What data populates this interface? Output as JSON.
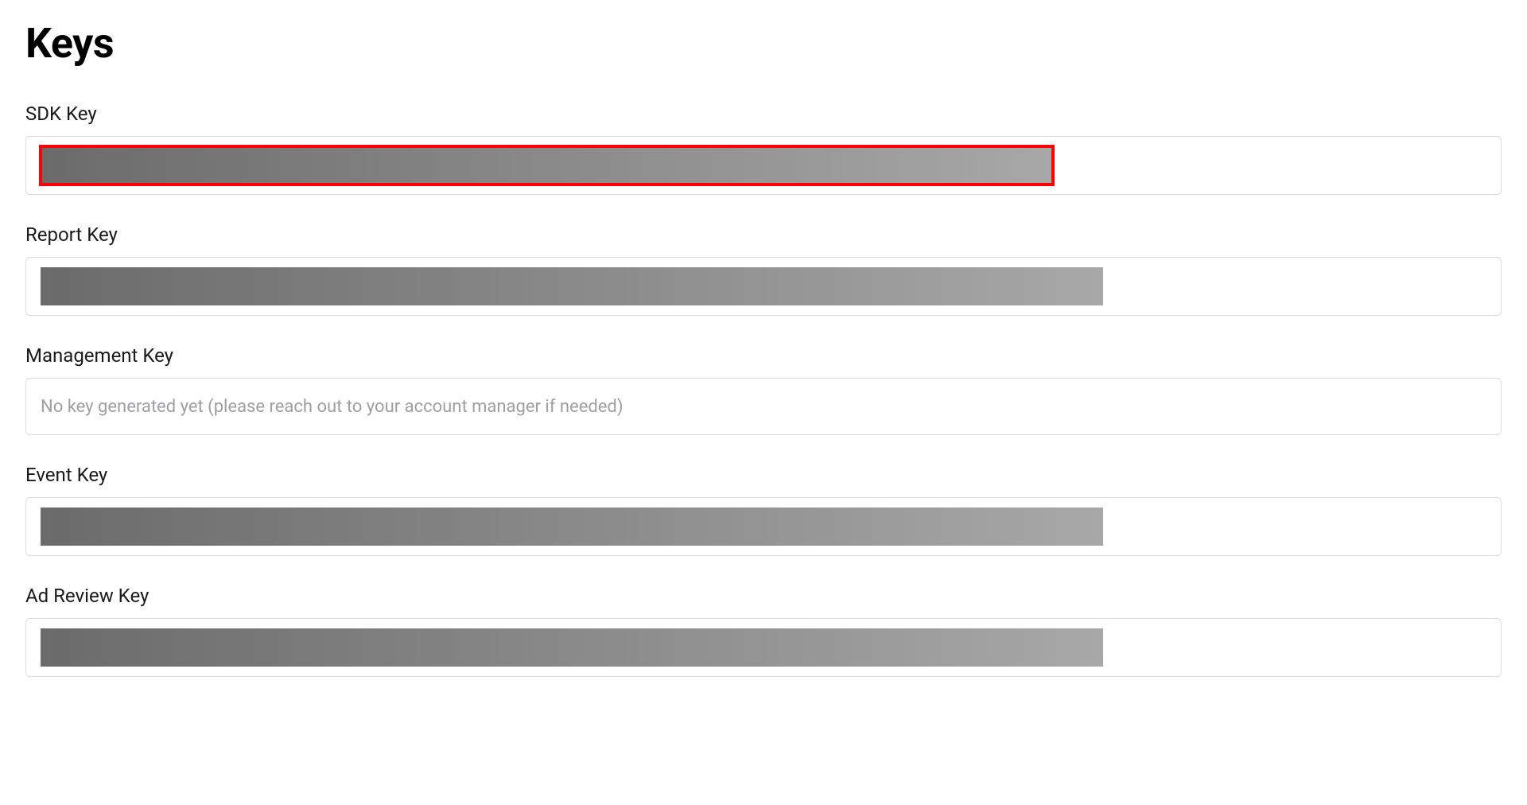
{
  "page": {
    "title": "Keys"
  },
  "keys": {
    "sdk": {
      "label": "SDK Key",
      "value_redacted": true,
      "highlighted": true
    },
    "report": {
      "label": "Report Key",
      "value_redacted": true,
      "highlighted": false
    },
    "management": {
      "label": "Management Key",
      "value_redacted": false,
      "placeholder": "No key generated yet (please reach out to your account manager if needed)",
      "highlighted": false
    },
    "event": {
      "label": "Event Key",
      "value_redacted": true,
      "highlighted": false
    },
    "ad_review": {
      "label": "Ad Review Key",
      "value_redacted": true,
      "highlighted": false
    }
  },
  "colors": {
    "highlight_border": "#ff0000",
    "field_border": "#dcdcdc",
    "placeholder_text": "#9aa0a6"
  }
}
